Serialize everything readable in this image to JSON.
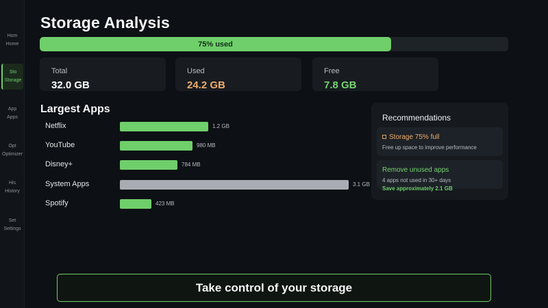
{
  "sidebar": {
    "items": [
      {
        "abbr": "Hom",
        "label": "Home",
        "active": false
      },
      {
        "abbr": "Sto",
        "label": "Storage",
        "active": true
      },
      {
        "abbr": "App",
        "label": "Apps",
        "active": false
      },
      {
        "abbr": "Opt",
        "label": "Optimizer",
        "active": false
      },
      {
        "abbr": "His",
        "label": "History",
        "active": false
      },
      {
        "abbr": "Set",
        "label": "Settings",
        "active": false
      }
    ]
  },
  "header": {
    "title": "Storage Analysis",
    "usage_label": "75% used",
    "usage_percent": 75
  },
  "stats": [
    {
      "label": "Total",
      "value": "32.0 GB",
      "color": "#ffffff"
    },
    {
      "label": "Used",
      "value": "24.2 GB",
      "color": "#f0ac6a"
    },
    {
      "label": "Free",
      "value": "7.8 GB",
      "color": "#76d36f"
    }
  ],
  "apps_section": {
    "title": "Largest Apps",
    "apps": [
      {
        "name": "Netflix",
        "size": "1.2 GB",
        "mb": 1200,
        "color": "#6fcf6a"
      },
      {
        "name": "YouTube",
        "size": "980 MB",
        "mb": 980,
        "color": "#6fcf6a"
      },
      {
        "name": "Disney+",
        "size": "784 MB",
        "mb": 784,
        "color": "#6fcf6a"
      },
      {
        "name": "System Apps",
        "size": "3.1 GB",
        "mb": 3100,
        "color": "#a9acb3"
      },
      {
        "name": "Spotify",
        "size": "423 MB",
        "mb": 423,
        "color": "#6fcf6a"
      }
    ]
  },
  "recommendations": {
    "title": "Recommendations",
    "items": [
      {
        "title": "Storage 75% full",
        "subtitle": "Free up space to improve performance",
        "extra": "",
        "color": "#f0ac6a",
        "icon": "warning-icon"
      },
      {
        "title": "Remove unused apps",
        "subtitle": "4 apps not used in 30+ days",
        "extra": "Save approximately 2.1 GB",
        "color": "#76d36f",
        "icon": ""
      }
    ]
  },
  "footer": {
    "cta": "Take control of your storage"
  },
  "colors": {
    "accent": "#6fcf6a",
    "warning": "#f0ac6a",
    "background": "#0d1014"
  }
}
